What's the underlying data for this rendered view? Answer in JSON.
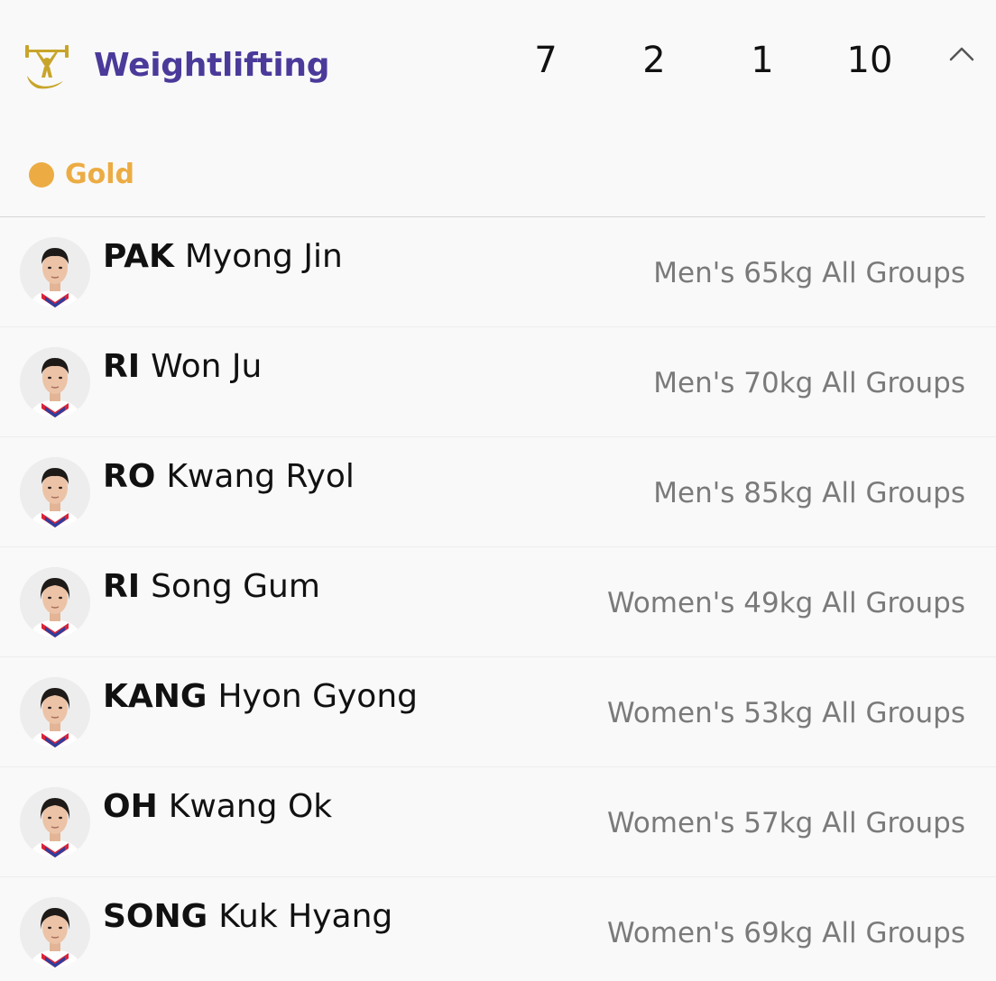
{
  "sport": {
    "title": "Weightlifting",
    "icon": "weightlifting-icon",
    "medals": {
      "gold": "7",
      "silver": "2",
      "bronze": "1",
      "total": "10"
    },
    "collapse_icon": "chevron-up-icon"
  },
  "medal_section": {
    "label": "Gold",
    "color": "#ecac43"
  },
  "colors": {
    "title": "#4b3a9a",
    "event_text": "#7a7a7a",
    "jersey_red": "#d9243a",
    "jersey_blue": "#2c3e9e"
  },
  "athletes": [
    {
      "surname": "PAK",
      "given_name": "Myong Jin",
      "event": "Men's 65kg All Groups",
      "avatar": "male-athlete-avatar"
    },
    {
      "surname": "RI",
      "given_name": "Won Ju",
      "event": "Men's 70kg All Groups",
      "avatar": "male-athlete-avatar"
    },
    {
      "surname": "RO",
      "given_name": "Kwang Ryol",
      "event": "Men's 85kg All Groups",
      "avatar": "male-athlete-avatar"
    },
    {
      "surname": "RI",
      "given_name": "Song Gum",
      "event": "Women's 49kg All Groups",
      "avatar": "female-athlete-avatar"
    },
    {
      "surname": "KANG",
      "given_name": "Hyon Gyong",
      "event": "Women's 53kg All Groups",
      "avatar": "female-athlete-avatar"
    },
    {
      "surname": "OH",
      "given_name": "Kwang Ok",
      "event": "Women's 57kg All Groups",
      "avatar": "female-athlete-avatar"
    },
    {
      "surname": "SONG",
      "given_name": "Kuk Hyang",
      "event": "Women's 69kg All Groups",
      "avatar": "female-athlete-avatar"
    }
  ]
}
